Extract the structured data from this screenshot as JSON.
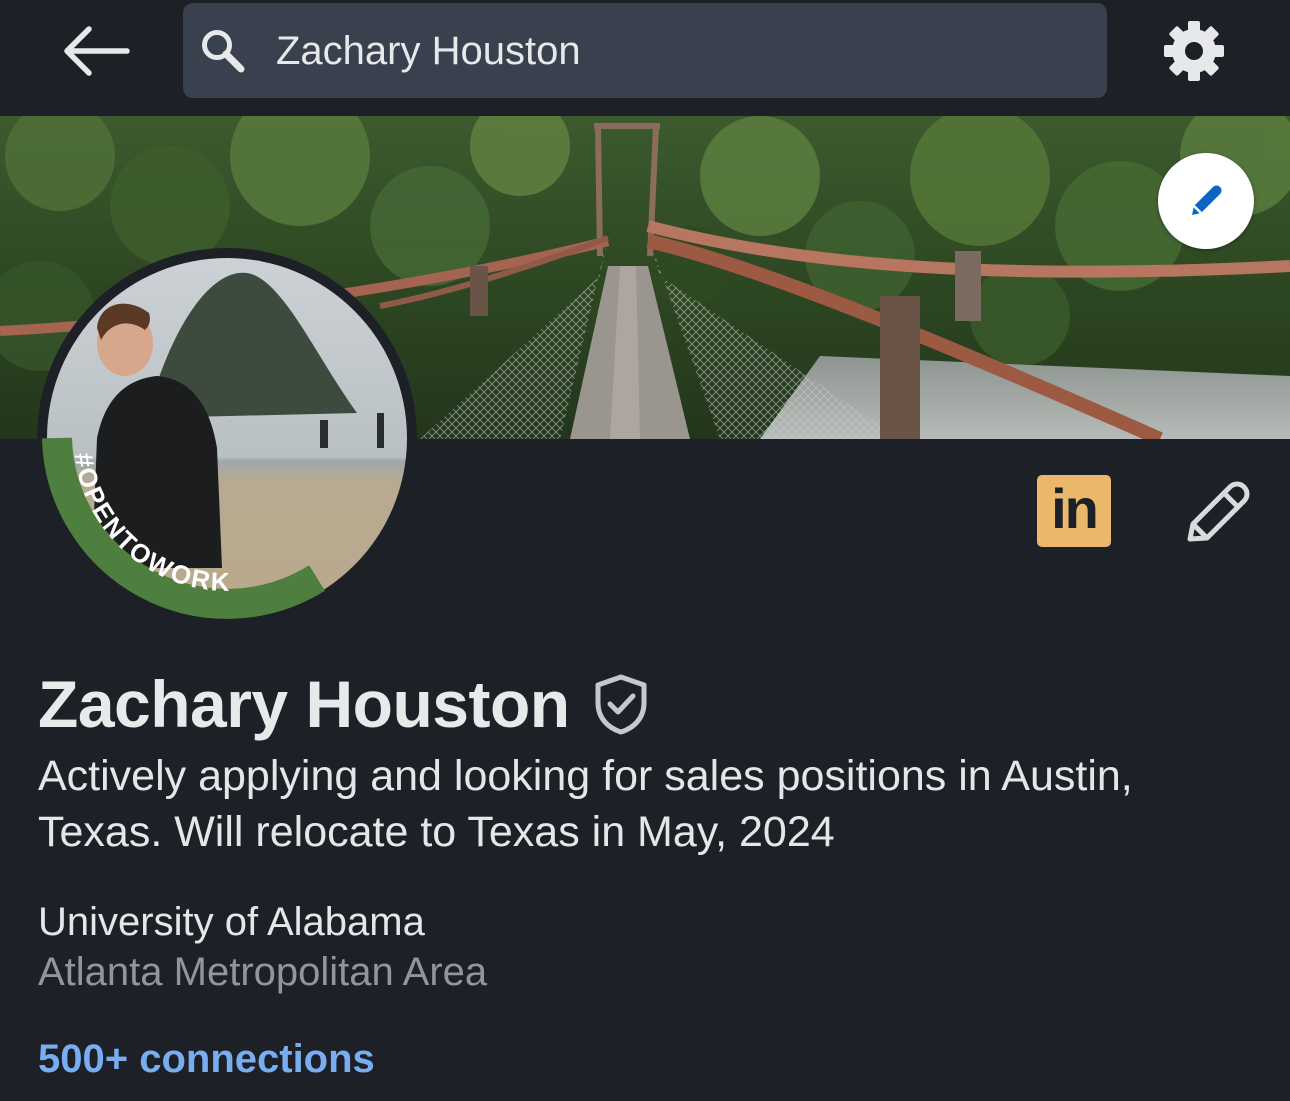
{
  "search": {
    "value": "Zachary Houston"
  },
  "icons": {
    "back": "arrow-left-icon",
    "search": "magnifier-icon",
    "settings": "gear-icon",
    "banner_edit": "pencil-icon",
    "linkedin": "linkedin-logo-icon",
    "profile_edit": "pencil-outline-icon",
    "verified": "shield-check-icon"
  },
  "profile": {
    "frame_label": "#OPENTOWORK",
    "linkedin_label": "in",
    "name": "Zachary Houston",
    "headline": "Actively applying and looking for sales positions in Austin, Texas. Will relocate to Texas in May, 2024",
    "school": "University of Alabama",
    "location": "Atlanta Metropolitan Area",
    "connections": "500+ connections"
  },
  "colors": {
    "background": "#1d2026",
    "search_bg": "#38414d",
    "open_to_work_green": "#4f7f3f",
    "linkedin_badge": "#e9b86c",
    "link_blue": "#78aef1",
    "edit_pencil_blue": "#0a66c2"
  }
}
